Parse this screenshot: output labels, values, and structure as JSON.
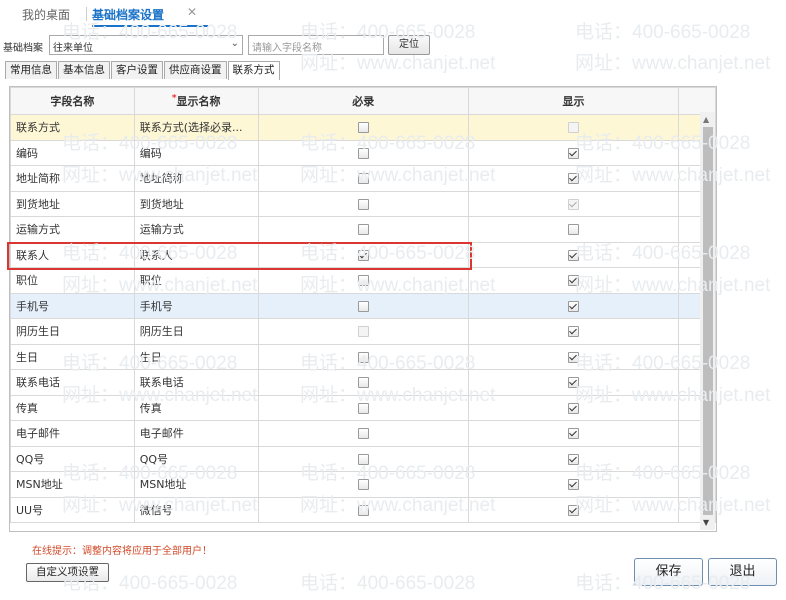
{
  "tabs": {
    "home": "我的桌面",
    "active": "基础档案设置",
    "close": "✕"
  },
  "toolbar": {
    "archive_label": "基础档案",
    "archive_value": "往来单位",
    "archive_arrow": "⌄",
    "search_placeholder": "请输入字段名称",
    "locate_label": "定位"
  },
  "subtabs": [
    "常用信息",
    "基本信息",
    "客户设置",
    "供应商设置",
    "联系方式"
  ],
  "grid": {
    "headers": {
      "field": "字段名称",
      "required_star": "*",
      "display": "显示名称",
      "required": "必录",
      "show": "显示"
    },
    "rows": [
      {
        "field": "联系方式",
        "display": "联系方式(选择必录...",
        "required": false,
        "required_disabled": false,
        "show": false,
        "show_disabled": true,
        "highlight": "yellow"
      },
      {
        "field": "编码",
        "display": "编码",
        "required": false,
        "required_disabled": false,
        "show": true,
        "show_disabled": false
      },
      {
        "field": "地址简称",
        "display": "地址简称",
        "required": false,
        "required_disabled": false,
        "show": true,
        "show_disabled": false
      },
      {
        "field": "到货地址",
        "display": "到货地址",
        "required": false,
        "required_disabled": false,
        "show": true,
        "show_disabled": true
      },
      {
        "field": "运输方式",
        "display": "运输方式",
        "required": false,
        "required_disabled": false,
        "show": false,
        "show_disabled": false
      },
      {
        "field": "联系人",
        "display": "联系人",
        "required": true,
        "required_disabled": false,
        "show": true,
        "show_disabled": false
      },
      {
        "field": "职位",
        "display": "职位",
        "required": false,
        "required_disabled": false,
        "show": true,
        "show_disabled": false
      },
      {
        "field": "手机号",
        "display": "手机号",
        "required": false,
        "required_disabled": false,
        "show": true,
        "show_disabled": false,
        "highlight": "blue"
      },
      {
        "field": "阴历生日",
        "display": "阴历生日",
        "required": false,
        "required_disabled": true,
        "show": true,
        "show_disabled": false
      },
      {
        "field": "生日",
        "display": "生日",
        "required": false,
        "required_disabled": false,
        "show": true,
        "show_disabled": false
      },
      {
        "field": "联系电话",
        "display": "联系电话",
        "required": false,
        "required_disabled": false,
        "show": true,
        "show_disabled": false
      },
      {
        "field": "传真",
        "display": "传真",
        "required": false,
        "required_disabled": false,
        "show": true,
        "show_disabled": false
      },
      {
        "field": "电子邮件",
        "display": "电子邮件",
        "required": false,
        "required_disabled": false,
        "show": true,
        "show_disabled": false
      },
      {
        "field": "QQ号",
        "display": "QQ号",
        "required": false,
        "required_disabled": false,
        "show": true,
        "show_disabled": false
      },
      {
        "field": "MSN地址",
        "display": "MSN地址",
        "required": false,
        "required_disabled": false,
        "show": true,
        "show_disabled": false
      },
      {
        "field": "UU号",
        "display": "微信号",
        "required": false,
        "required_disabled": false,
        "show": true,
        "show_disabled": false
      }
    ]
  },
  "scrollbar": {
    "up": "▲",
    "down": "▼"
  },
  "footer": {
    "hint": "在线提示：调整内容将应用于全部用户！",
    "custom_button": "自定义项设置",
    "save_button": "保存",
    "exit_button": "退出"
  },
  "watermark": {
    "phone": "电话：400-665-0028",
    "web": "网址：www.chanjet.net"
  }
}
